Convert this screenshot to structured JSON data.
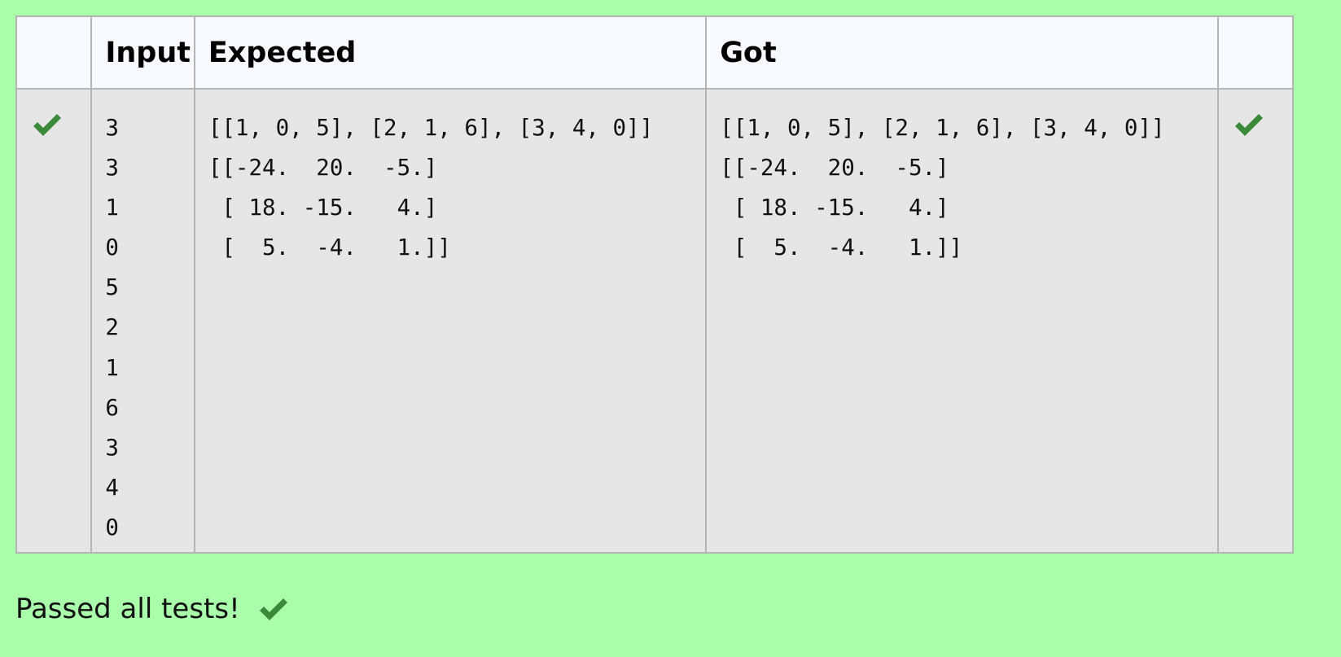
{
  "table": {
    "headers": [
      "",
      "Input",
      "Expected",
      "Got",
      ""
    ],
    "row": {
      "passed_icon": "check-icon",
      "input": "3\n3\n1\n0\n5\n2\n1\n6\n3\n4\n0",
      "expected": "[[1, 0, 5], [2, 1, 6], [3, 4, 0]]\n[[-24.  20.  -5.]\n [ 18. -15.   4.]\n [  5.  -4.   1.]]",
      "got": "[[1, 0, 5], [2, 1, 6], [3, 4, 0]]\n[[-24.  20.  -5.]\n [ 18. -15.   4.]\n [  5.  -4.   1.]]",
      "result_icon": "check-icon"
    }
  },
  "summary": {
    "text": "Passed all tests!",
    "icon": "check-icon"
  },
  "colors": {
    "background": "#aaffaa",
    "check": "#3a8a3a",
    "header_bg": "#f8f9fe",
    "cell_bg": "#e6e6e6",
    "border": "#b4b4b4"
  }
}
